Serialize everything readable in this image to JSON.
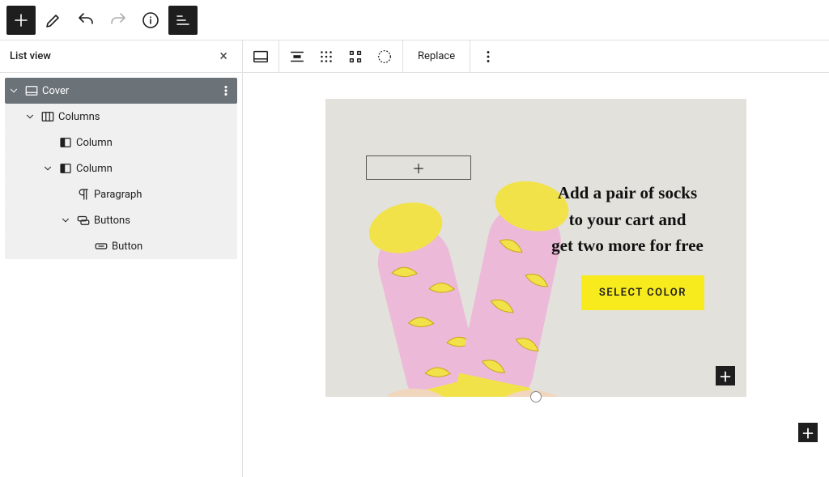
{
  "toolbar": {
    "add_label": "+",
    "replace_label": "Replace"
  },
  "sidebar": {
    "title": "List view",
    "tree": {
      "cover": "Cover",
      "columns": "Columns",
      "column1": "Column",
      "column2": "Column",
      "paragraph": "Paragraph",
      "buttons": "Buttons",
      "button": "Button"
    }
  },
  "cover": {
    "line1": "Add a pair of socks",
    "line2": "to your cart and",
    "line3": "get two more for free",
    "cta": "SELECT COLOR",
    "colors": {
      "cta_bg": "#f7ea1d",
      "sock_pink": "#edb9d8",
      "sock_yellow": "#f2e24a",
      "wall": "#e3e1dc"
    }
  }
}
